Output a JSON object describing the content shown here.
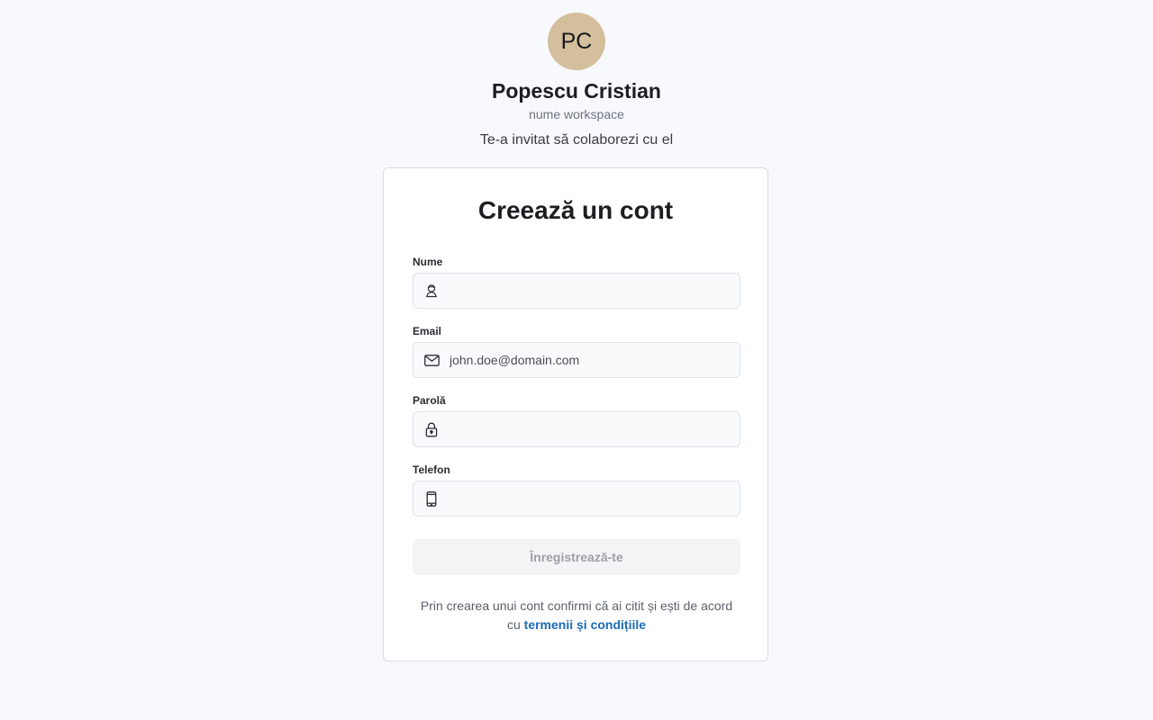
{
  "inviter": {
    "initials": "PC",
    "name": "Popescu Cristian",
    "workspace": "nume workspace",
    "message": "Te-a invitat să colaborezi cu el"
  },
  "form": {
    "title": "Creează un cont",
    "fields": [
      {
        "label": "Nume",
        "icon": "user-icon",
        "value": "",
        "placeholder": ""
      },
      {
        "label": "Email",
        "icon": "mail-icon",
        "value": "",
        "placeholder": "john.doe@domain.com"
      },
      {
        "label": "Parolă",
        "icon": "lock-icon",
        "value": "",
        "placeholder": ""
      },
      {
        "label": "Telefon",
        "icon": "phone-icon",
        "value": "",
        "placeholder": ""
      }
    ],
    "submit_label": "Înregistrează-te",
    "terms_text": "Prin crearea unui cont confirmi că ai citit și ești de acord cu",
    "terms_link": "termenii și condițiile"
  },
  "colors": {
    "avatar_bg": "#d4bf9c",
    "link": "#1c6ab8",
    "page_bg": "#f8f9fc"
  }
}
